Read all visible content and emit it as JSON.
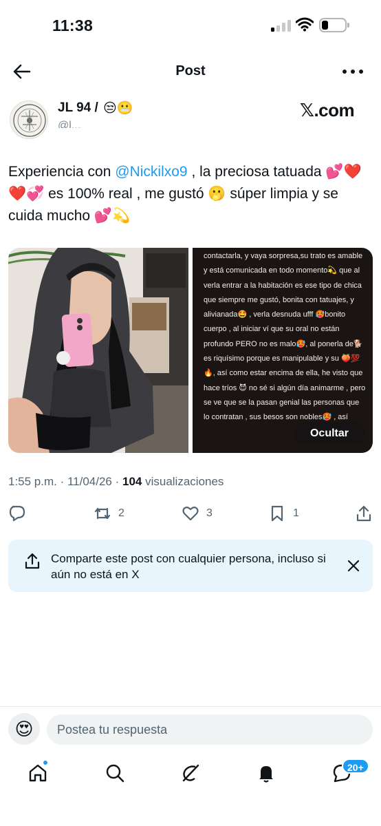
{
  "status_bar": {
    "time": "11:38",
    "signal_bars_active": 1,
    "signal_bars_total": 4,
    "battery_level": 0.2
  },
  "header": {
    "title": "Post",
    "back_icon": "arrow-left-icon",
    "more_icon": "more-horizontal-icon"
  },
  "author": {
    "name": "JL 94 /",
    "name_emoji": "😒😬",
    "handle": "@l...",
    "watermark": "𝕏.com"
  },
  "tweet": {
    "text_before": "Experiencia con ",
    "mention": "@Nickilxo9",
    "text_after": " , la preciosa tatuada 💕❤️❤️💞  es 100% real , me gustó 🫢  súper limpia y se cuida mucho 💕💫"
  },
  "media": {
    "notes_text": "contactarla, y vaya sorpresa,su trato es amable y está comunicada en todo momento💫 que al verla entrar a la habitación es ese tipo de chica que siempre me gustó, bonita con tatuajes, y alivianada🤩 , verla desnuda ufff 🥵bonito cuerpo , al iniciar ví que su oral no están profundo PERO no es malo🥵, al ponerla de🐕 es riquísimo porque es manipulable y su 🍑💯🔥, así como estar encima de ella, he visto que hace tríos 😈 no sé si algún día animarme , pero se ve que se la pasan genial las personas que lo contratan , sus besos son nobles🥵 , así",
    "hide_label": "Ocultar"
  },
  "meta": {
    "time": "1:55 p.m. · 11/04/26 · ",
    "views_count": "104",
    "views_label": " visualizaciones"
  },
  "actions": {
    "reply_icon": "reply-icon",
    "repost_count": "2",
    "like_count": "3",
    "bookmark_count": "1",
    "share_icon": "share-icon"
  },
  "share_card": {
    "text": "Comparte este post con cualquier persona, incluso si aún no está en X",
    "close_icon": "close-icon"
  },
  "reply": {
    "emoji": "😍",
    "placeholder": "Postea tu respuesta"
  },
  "nav": {
    "items": [
      "home-icon",
      "search-icon",
      "grok-icon",
      "notifications-icon",
      "messages-icon"
    ],
    "messages_badge": "20+"
  },
  "colors": {
    "accent": "#1d9bf0",
    "text": "#0f1419",
    "secondary": "#536471",
    "share_card_bg": "#e8f5fd"
  }
}
